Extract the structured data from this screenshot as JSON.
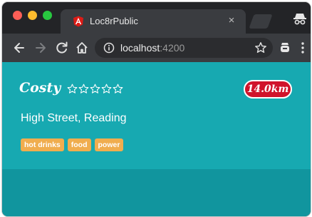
{
  "browser": {
    "tab": {
      "title": "Loc8rPublic",
      "close_label": "×",
      "favicon": "angular-icon"
    },
    "address_bar": {
      "host": "localhost",
      "port": ":4200"
    },
    "icons": [
      "back-icon",
      "forward-icon",
      "reload-icon",
      "home-icon",
      "info-icon",
      "star-icon",
      "extension-icon",
      "menu-icon",
      "incognito-icon"
    ]
  },
  "location": {
    "name": "Costy",
    "rating": 0,
    "rating_max": 5,
    "distance": "14.0km",
    "address": "High Street, Reading",
    "facilities": [
      "hot drinks",
      "food",
      "power"
    ]
  },
  "colors": {
    "page_background": "#17a9b1",
    "distance_badge": "#d0132b",
    "facility_badge": "#f0ad4e"
  }
}
